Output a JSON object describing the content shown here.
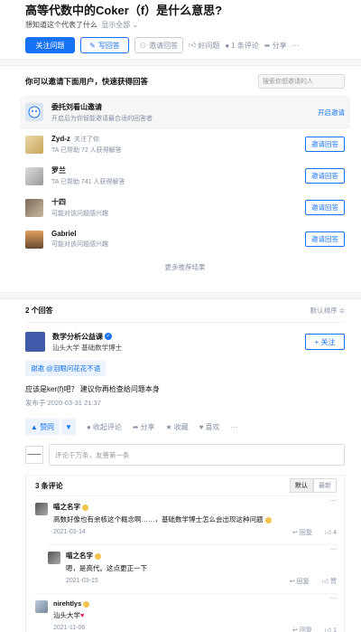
{
  "question": {
    "title": "高等代数中的Coker（f）是什么意思?",
    "subtitle": "想知道这个代表了什么",
    "subtitle_more": "显示全部 ⌄",
    "actions": {
      "follow": "关注问题",
      "write": "写回答",
      "invite": "邀请回答",
      "good": "好问题",
      "comments": "1 条评论",
      "share": "分享",
      "more": "···"
    }
  },
  "invite": {
    "title": "你可以邀请下面用户，快速获得回答",
    "search_placeholder": "搜索你想邀请的人",
    "rows": [
      {
        "name": "委托刘看山邀请",
        "desc": "开启后为你智能邀请最合适的回答者",
        "action": "开启邀请",
        "follow": ""
      },
      {
        "name": "Zyd-z",
        "desc": "TA 已帮助 72 人获得解答",
        "action": "邀请回答",
        "follow": "关注了你"
      },
      {
        "name": "罗兰",
        "desc": "TA 已帮助 741 人获得解答",
        "action": "邀请回答",
        "follow": ""
      },
      {
        "name": "十四",
        "desc": "可能对该问题感兴趣",
        "action": "邀请回答",
        "follow": ""
      },
      {
        "name": "Gabriel",
        "desc": "可能对该问题感兴趣",
        "action": "邀请回答",
        "follow": ""
      }
    ],
    "more": "更多推荐结果"
  },
  "answers": {
    "count": "2 个回答",
    "sort": "默认排序 ≎",
    "author": {
      "name": "数学分析公益课",
      "desc": "汕头大学 基础数学博士",
      "follow": "+ 关注"
    },
    "thanks": "谢邀 @泪眼问花花不语",
    "text": "应该是ker(f)吧？ 建议你再检查给问题本身",
    "date": "发布于 2020-03-31 21:37",
    "actions": {
      "upvote": "▲ 赞同",
      "downvote": "▼",
      "comments": "收起评论",
      "share": "分享",
      "favorite": "收藏",
      "like": "喜欢",
      "more": "···"
    },
    "comment_placeholder": "评论千万条，友善第一条",
    "my_avatar_text": "━━━━━",
    "comments": {
      "count": "3 条评论",
      "tabs": [
        "默认",
        "最新"
      ],
      "items": [
        {
          "name": "喵之名字",
          "text": "高数好像也有余核这个概念啊……，基础数学博士怎么会出现这种问题",
          "date": "2021-03-14",
          "reply": "回复",
          "likes": "4"
        },
        {
          "name": "喵之名字",
          "text": "嗯，是高代。这点更正一下",
          "date": "2021-03-15",
          "reply": "回复",
          "likes": "赞"
        },
        {
          "name": "nirehtlys",
          "text": "汕头大学",
          "date": "2021-11-06",
          "reply": "回复",
          "likes": "1"
        }
      ]
    }
  },
  "colors": {
    "accent": "#1772f6",
    "gray": "#8590a6"
  }
}
